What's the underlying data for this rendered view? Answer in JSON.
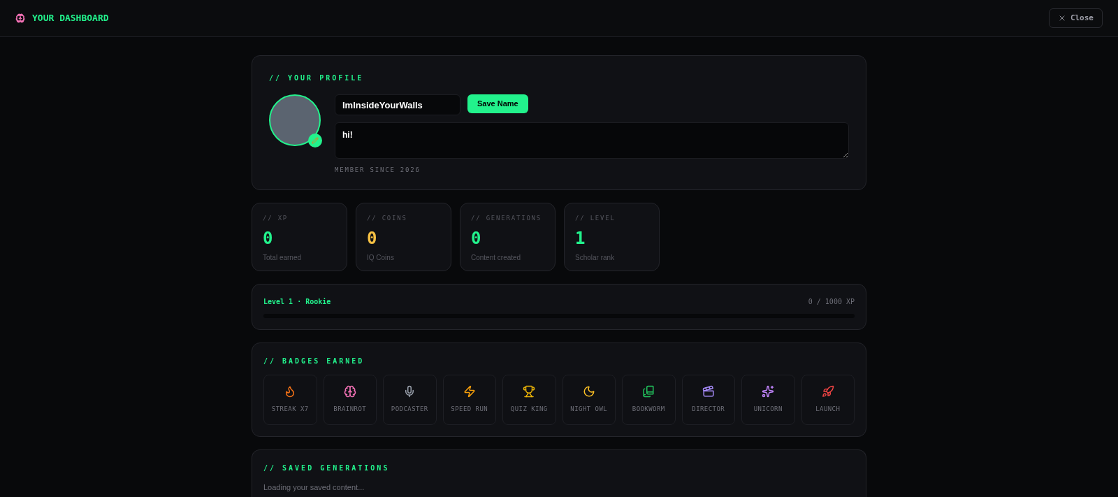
{
  "header": {
    "title": "YOUR DASHBOARD",
    "close_label": "Close"
  },
  "profile": {
    "heading": "// YOUR PROFILE",
    "name_value": "ImInsideYourWalls",
    "save_label": "Save Name",
    "bio_value": "hi!",
    "member_since": "MEMBER SINCE 2026"
  },
  "stats": [
    {
      "label": "// XP",
      "value": "0",
      "caption": "Total earned",
      "color": "#22f28c"
    },
    {
      "label": "// COINS",
      "value": "0",
      "caption": "IQ Coins",
      "color": "#f5c043"
    },
    {
      "label": "// GENERATIONS",
      "value": "0",
      "caption": "Content created",
      "color": "#22f28c"
    },
    {
      "label": "// LEVEL",
      "value": "1",
      "caption": "Scholar rank",
      "color": "#22f28c"
    }
  ],
  "progress": {
    "label": "Level 1 · Rookie",
    "reading": "0 / 1000 XP",
    "level": 0
  },
  "badges": {
    "heading": "// BADGES EARNED",
    "items": [
      {
        "label": "STREAK X7"
      },
      {
        "label": "BRAINROT"
      },
      {
        "label": "PODCASTER"
      },
      {
        "label": "SPEED RUN"
      },
      {
        "label": "QUIZ KING"
      },
      {
        "label": "NIGHT OWL"
      },
      {
        "label": "BOOKWORM"
      },
      {
        "label": "DIRECTOR"
      },
      {
        "label": "UNICORN"
      },
      {
        "label": "LAUNCH"
      }
    ]
  },
  "saved": {
    "heading": "// SAVED GENERATIONS",
    "status": "Loading your saved content..."
  }
}
